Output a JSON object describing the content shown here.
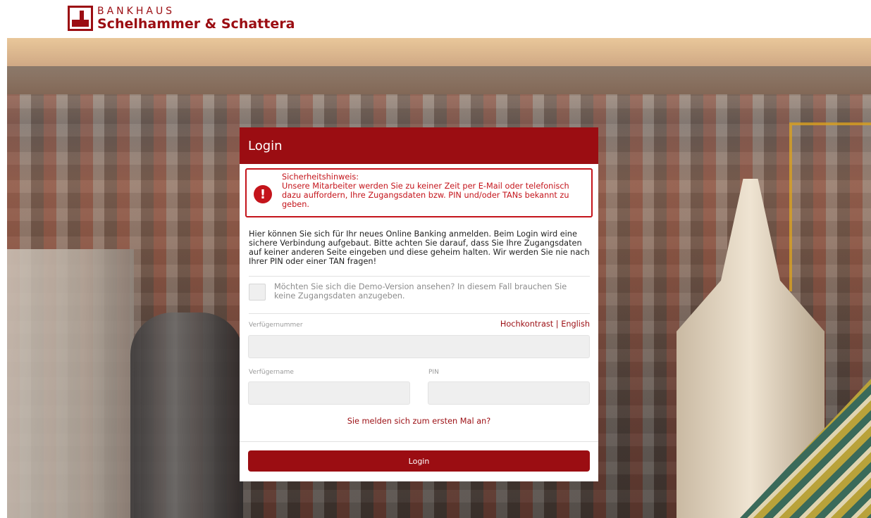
{
  "brand": {
    "line1": "BANKHAUS",
    "line2": "Schelhammer & Schattera",
    "color": "#9b0d12"
  },
  "login": {
    "title": "Login",
    "alert": {
      "heading": "Sicherheitshinweis:",
      "text": "Unsere Mitarbeiter werden Sie zu keiner Zeit per E-Mail oder telefonisch dazu auffordern, Ihre Zugangsdaten bzw. PIN und/oder TANs bekannt zu geben.",
      "icon": "exclamation-icon",
      "color": "#c4141b"
    },
    "intro": "Hier können Sie sich für Ihr neues Online Banking anmelden. Beim Login wird eine sichere Verbindung aufgebaut. Bitte achten Sie darauf, dass Sie Ihre Zugangsdaten auf keiner anderen Seite eingeben und diese geheim halten. Wir werden Sie nie nach Ihrer PIN oder einer TAN fragen!",
    "demo_text": "Möchten Sie sich die Demo-Version ansehen? In diesem Fall brauchen Sie keine Zugangsdaten anzugeben.",
    "links": {
      "contrast": "Hochkontrast",
      "separator": " | ",
      "english": "English"
    },
    "fields": {
      "number_label": "Verfügernummer",
      "number_value": "",
      "name_label": "Verfügername",
      "name_value": "",
      "pin_label": "PIN",
      "pin_value": ""
    },
    "first_time": "Sie melden sich zum ersten Mal an?",
    "button": "Login"
  }
}
